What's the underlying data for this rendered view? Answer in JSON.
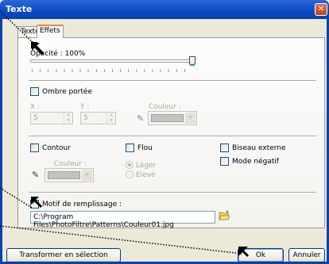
{
  "window": {
    "title": "Texte",
    "close_symbol": "✕"
  },
  "tabs": [
    {
      "label": "Texte"
    },
    {
      "label": "Effets"
    }
  ],
  "opacity": {
    "label": "Opacité : 100%",
    "value_percent": 100
  },
  "shadow": {
    "label": "Ombre portée",
    "checked": false,
    "x_label": "X :",
    "x_value": "5",
    "y_label": "Y :",
    "y_value": "5",
    "color_label": "Couleur :"
  },
  "outline": {
    "label": "Contour",
    "checked": false,
    "color_label": "Couleur :"
  },
  "blur": {
    "label": "Flou",
    "checked": false,
    "options": [
      "Léger",
      "Elevé"
    ],
    "selected": "Léger"
  },
  "bevel": {
    "label": "Biseau externe",
    "checked": false
  },
  "negative": {
    "label": "Mode négatif",
    "checked": false
  },
  "pattern": {
    "label": "Motif de remplissage :",
    "checked": true,
    "path": "C:\\Program Files\\PhotoFiltre\\Patterns\\Couleur01.jpg"
  },
  "buttons": {
    "transform": "Transformer en sélection",
    "ok": "Ok",
    "cancel": "Annuler"
  },
  "icons": {
    "close": "close-icon",
    "dropper": "eyedropper-icon",
    "folder": "folder-open-icon",
    "pointer": "arrow-pointer-icon"
  },
  "colors": {
    "title_bar": "#0a49c3",
    "dialog_bg": "#ece9d8",
    "active_tab_accent": "#e68b2c",
    "check_green": "#21a121"
  }
}
